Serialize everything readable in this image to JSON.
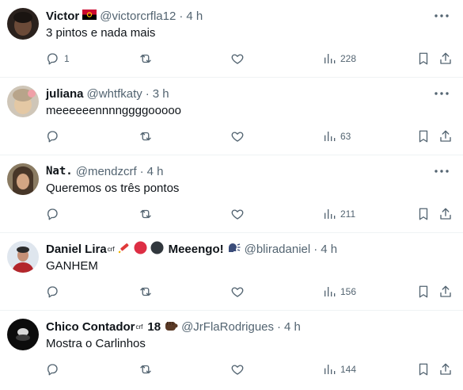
{
  "tweets": [
    {
      "name": "Victor",
      "name_suffix": "",
      "handle": "@victorcrfla12",
      "time": "4 h",
      "text": "3 pintos e nada mais",
      "replies": "1",
      "views": "228"
    },
    {
      "name": "juliana",
      "name_suffix": "",
      "handle": "@whtfkaty",
      "time": "3 h",
      "text": "meeeeeennnnggggooooo",
      "replies": "",
      "views": "63"
    },
    {
      "name": "Nat.",
      "name_suffix": "",
      "handle": "@mendzcrf",
      "time": "4 h",
      "text": "Queremos os três pontos",
      "replies": "",
      "views": "211"
    },
    {
      "name": "Daniel Lira",
      "name_suffix": "crf",
      "name_extra": "Meeengo!",
      "handle": "@bliradaniel",
      "time": "4 h",
      "text": "GANHEM",
      "replies": "",
      "views": "156"
    },
    {
      "name": "Chico Contador",
      "name_suffix": "crf",
      "name_extra": "18",
      "handle": "@JrFlaRodrigues",
      "time": "4 h",
      "text": "Mostra o Carlinhos",
      "replies": "",
      "views": "144"
    }
  ],
  "separator": "·",
  "colors": {
    "text": "#0f1419",
    "muted": "#536471",
    "border": "#eff3f4",
    "flamengo_red": "#d32f2f"
  },
  "icons": [
    "reply-icon",
    "retweet-icon",
    "like-icon",
    "views-icon",
    "bookmark-icon",
    "share-icon",
    "more-icon",
    "angola-flag-icon",
    "firecracker-icon",
    "red-circle-icon",
    "black-circle-icon",
    "speaking-head-icon",
    "fist-icon"
  ]
}
